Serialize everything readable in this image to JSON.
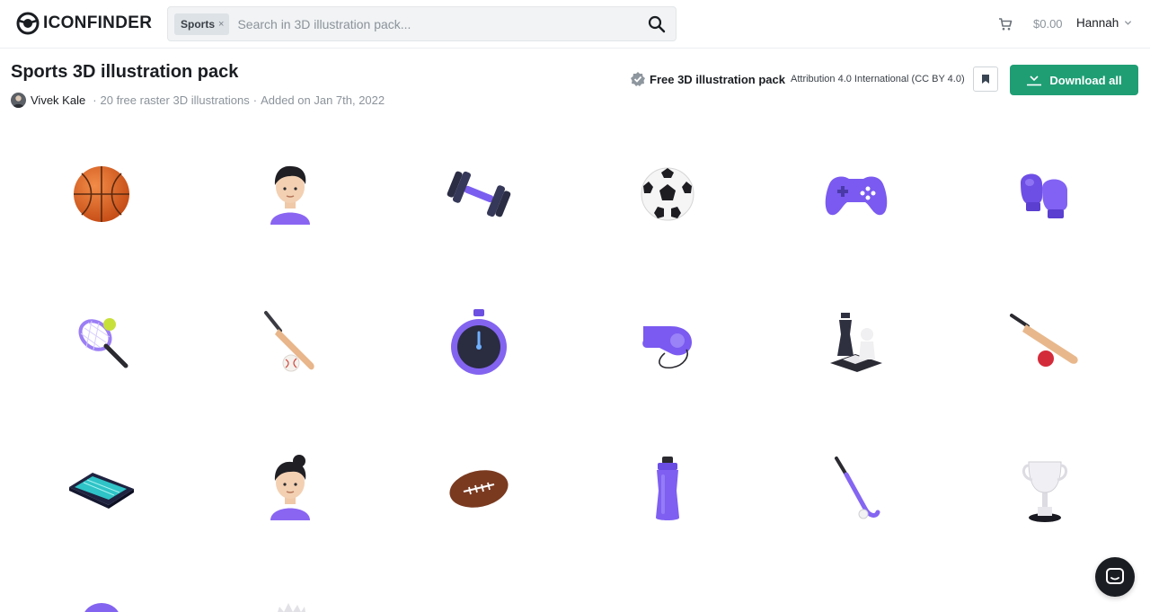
{
  "header": {
    "logo_text": "ICONFINDER",
    "search": {
      "chip_label": "Sports",
      "chip_close": "×",
      "placeholder": "Search in 3D illustration pack..."
    },
    "balance": "$0.00",
    "user_name": "Hannah"
  },
  "pack": {
    "title": "Sports 3D illustration pack",
    "author": "Vivek Kale",
    "count_text": "20 free raster 3D illustrations",
    "added_text": "Added on Jan 7th, 2022",
    "separator": "·",
    "license_title": "Free 3D illustration pack",
    "license_name": "Attribution 4.0 International (CC BY 4.0)",
    "download_label": "Download all"
  },
  "illustrations": [
    "basketball-icon",
    "boy-avatar-icon",
    "dumbbell-icon",
    "soccer-ball-icon",
    "gamepad-icon",
    "boxing-gloves-icon",
    "tennis-racket-icon",
    "baseball-bat-icon",
    "stopwatch-icon",
    "whistle-icon",
    "chess-icon",
    "cricket-bat-icon",
    "swimming-pool-icon",
    "girl-avatar-icon",
    "american-football-icon",
    "water-bottle-icon",
    "hockey-stick-icon",
    "trophy-icon",
    "partial-illustration-icon",
    "partial-illustration-icon"
  ],
  "colors": {
    "accent_green": "#1f9e74",
    "purple": "#7b5cf0",
    "dark": "#1a1d21"
  }
}
